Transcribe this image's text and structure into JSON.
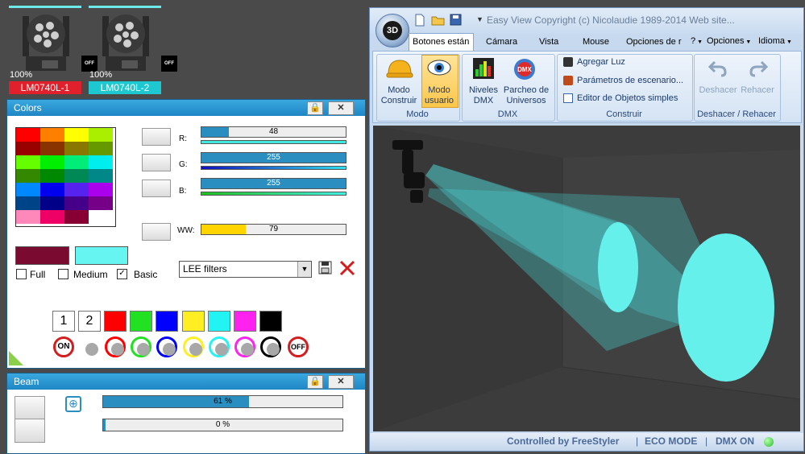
{
  "fixtures": [
    {
      "name": "LM0740L-1",
      "percent": "100%",
      "off": "OFF",
      "label_color": "#e0202a"
    },
    {
      "name": "LM0740L-2",
      "percent": "100%",
      "off": "OFF",
      "label_color": "#1ec8d0"
    }
  ],
  "colors_panel": {
    "title": "Colors",
    "channels": [
      {
        "label": "R:",
        "value": "48",
        "level": 0.19
      },
      {
        "label": "G:",
        "value": "255",
        "level": 1.0
      },
      {
        "label": "B:",
        "value": "255",
        "level": 1.0
      },
      {
        "label": "WW:",
        "value": "79",
        "level": 0.31
      }
    ],
    "options": [
      "Full",
      "Medium",
      "Basic"
    ],
    "checked": "Basic",
    "filter_select": "LEE filters",
    "preset_numbers": [
      "1",
      "2"
    ],
    "on_label": "ON",
    "off_label": "OFF",
    "current_color": "#7a0a30",
    "preview_color": "#66f5f0"
  },
  "beam_panel": {
    "title": "Beam",
    "sliders": [
      {
        "value": "61 %",
        "level": 0.61
      },
      {
        "value": "0 %",
        "level": 0.0
      }
    ]
  },
  "app": {
    "title": "Easy View   Copyright (c) Nicolaudie 1989-2014   Web site...",
    "logo": "3D",
    "tabs": [
      "Botones están",
      "Cámara",
      "Vista",
      "Mouse",
      "Opciones de r"
    ],
    "right_menu": [
      "?",
      "Opciones",
      "Idioma"
    ],
    "groups": {
      "modo": {
        "label": "Modo",
        "buttons": [
          "Modo\nConstruir",
          "Modo\nusuario"
        ]
      },
      "dmx": {
        "label": "DMX",
        "buttons": [
          "Niveles\nDMX",
          "Parcheo de\nUniversos"
        ]
      },
      "construir": {
        "label": "Construir",
        "items": [
          "Agregar Luz",
          "Parámetros de escenario...",
          "Editor de Objetos simples"
        ]
      },
      "deshacer": {
        "label": "Deshacer / Rehacer",
        "buttons": [
          "Deshacer",
          "Rehacer"
        ]
      }
    },
    "status": {
      "controlled": "Controlled by FreeStyler",
      "eco": "ECO MODE",
      "dmx": "DMX ON"
    }
  }
}
